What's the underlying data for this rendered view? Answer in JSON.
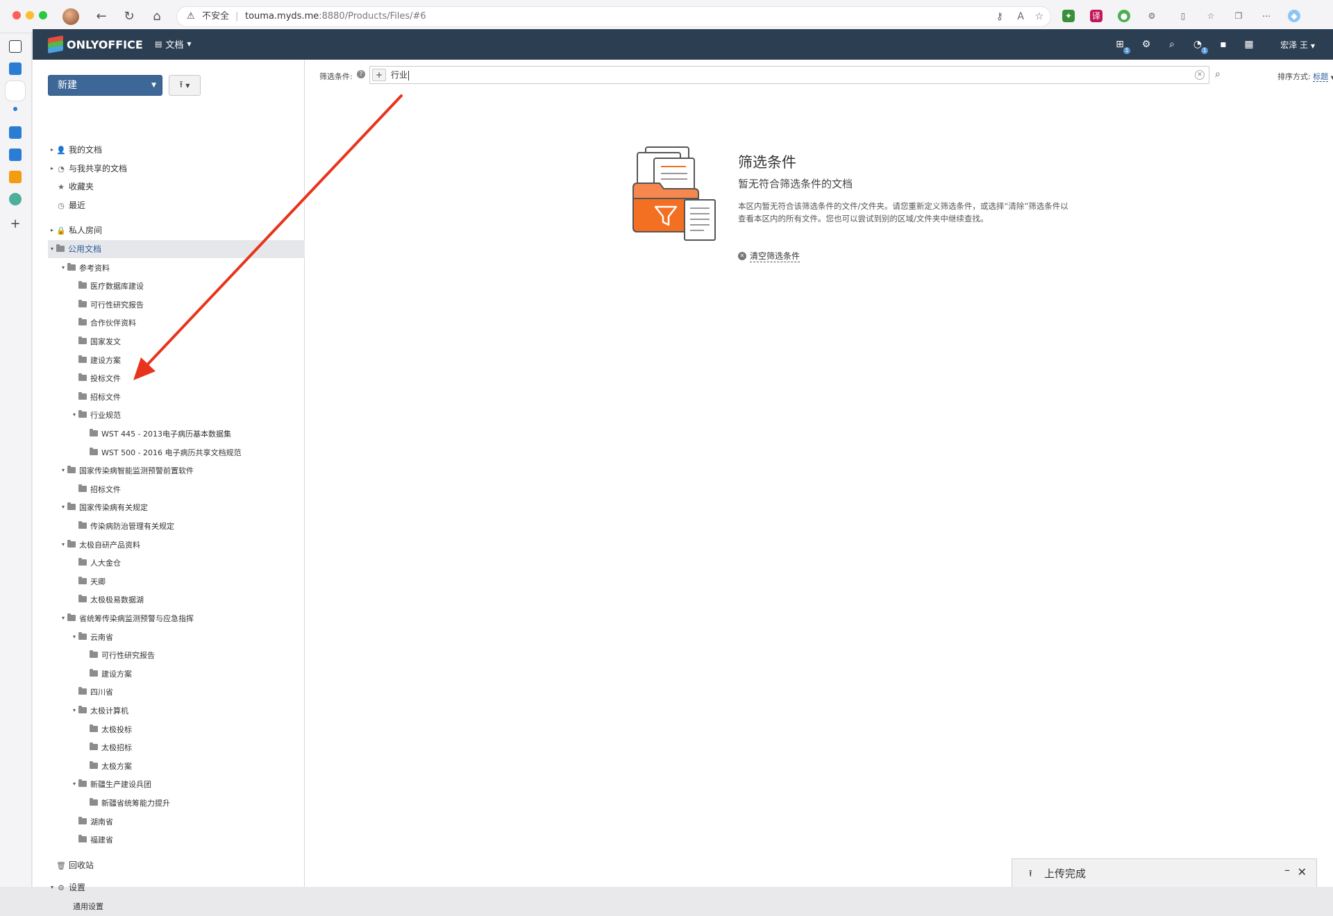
{
  "browser": {
    "insecure_label": "不安全",
    "url_host": "touma.myds.me",
    "url_rest": ":8880/Products/Files/#6"
  },
  "app": {
    "logo_text": "ONLYOFFICE",
    "module_label": "文档",
    "user_name": "宏泽 王",
    "badge_count": "1"
  },
  "sidebar": {
    "new_button": "新建",
    "tree": [
      {
        "label": "我的文档",
        "indent": 0,
        "toggle": "▸",
        "icon": "user-icon"
      },
      {
        "label": "与我共享的文档",
        "indent": 0,
        "toggle": "▸",
        "icon": "share-icon"
      },
      {
        "label": "收藏夹",
        "indent": 0,
        "toggle": "",
        "icon": "star-icon"
      },
      {
        "label": "最近",
        "indent": 0,
        "toggle": "",
        "icon": "clock-icon"
      },
      {
        "label": "私人房间",
        "indent": 0,
        "toggle": "▸",
        "icon": "lock-icon"
      },
      {
        "label": "公用文档",
        "indent": 0,
        "toggle": "▾",
        "icon": "folder-icon",
        "selected": true
      },
      {
        "label": "参考资料",
        "indent": 1,
        "toggle": "▾",
        "icon": "folder-icon"
      },
      {
        "label": "医疗数据库建设",
        "indent": 2,
        "toggle": "",
        "icon": "folder-icon"
      },
      {
        "label": "可行性研究报告",
        "indent": 2,
        "toggle": "",
        "icon": "folder-icon"
      },
      {
        "label": "合作伙伴资料",
        "indent": 2,
        "toggle": "",
        "icon": "folder-icon"
      },
      {
        "label": "国家发文",
        "indent": 2,
        "toggle": "",
        "icon": "folder-icon"
      },
      {
        "label": "建设方案",
        "indent": 2,
        "toggle": "",
        "icon": "folder-icon"
      },
      {
        "label": "投标文件",
        "indent": 2,
        "toggle": "",
        "icon": "folder-icon"
      },
      {
        "label": "招标文件",
        "indent": 2,
        "toggle": "",
        "icon": "folder-icon"
      },
      {
        "label": "行业规范",
        "indent": 2,
        "toggle": "▾",
        "icon": "folder-icon"
      },
      {
        "label": "WST 445 - 2013电子病历基本数据集",
        "indent": 3,
        "toggle": "",
        "icon": "folder-icon"
      },
      {
        "label": "WST 500 - 2016 电子病历共享文档规范",
        "indent": 3,
        "toggle": "",
        "icon": "folder-icon"
      },
      {
        "label": "国家传染病智能监测预警前置软件",
        "indent": 1,
        "toggle": "▾",
        "icon": "folder-icon"
      },
      {
        "label": "招标文件",
        "indent": 2,
        "toggle": "",
        "icon": "folder-icon"
      },
      {
        "label": "国家传染病有关规定",
        "indent": 1,
        "toggle": "▾",
        "icon": "folder-icon"
      },
      {
        "label": "传染病防治管理有关规定",
        "indent": 2,
        "toggle": "",
        "icon": "folder-icon"
      },
      {
        "label": "太极自研产品资料",
        "indent": 1,
        "toggle": "▾",
        "icon": "folder-icon"
      },
      {
        "label": "人大金仓",
        "indent": 2,
        "toggle": "",
        "icon": "folder-icon"
      },
      {
        "label": "天卿",
        "indent": 2,
        "toggle": "",
        "icon": "folder-icon"
      },
      {
        "label": "太极极易数据湖",
        "indent": 2,
        "toggle": "",
        "icon": "folder-icon"
      },
      {
        "label": "省统筹传染病监测预警与应急指挥",
        "indent": 1,
        "toggle": "▾",
        "icon": "folder-icon"
      },
      {
        "label": "云南省",
        "indent": 2,
        "toggle": "▾",
        "icon": "folder-icon"
      },
      {
        "label": "可行性研究报告",
        "indent": 3,
        "toggle": "",
        "icon": "folder-icon"
      },
      {
        "label": "建设方案",
        "indent": 3,
        "toggle": "",
        "icon": "folder-icon"
      },
      {
        "label": "四川省",
        "indent": 2,
        "toggle": "",
        "icon": "folder-icon"
      },
      {
        "label": "太极计算机",
        "indent": 2,
        "toggle": "▾",
        "icon": "folder-icon"
      },
      {
        "label": "太极投标",
        "indent": 3,
        "toggle": "",
        "icon": "folder-icon"
      },
      {
        "label": "太极招标",
        "indent": 3,
        "toggle": "",
        "icon": "folder-icon"
      },
      {
        "label": "太极方案",
        "indent": 3,
        "toggle": "",
        "icon": "folder-icon"
      },
      {
        "label": "新疆生产建设兵团",
        "indent": 2,
        "toggle": "▾",
        "icon": "folder-icon"
      },
      {
        "label": "新疆省统筹能力提升",
        "indent": 3,
        "toggle": "",
        "icon": "folder-icon"
      },
      {
        "label": "湖南省",
        "indent": 2,
        "toggle": "",
        "icon": "folder-icon"
      },
      {
        "label": "福建省",
        "indent": 2,
        "toggle": "",
        "icon": "folder-icon"
      },
      {
        "label": "回收站",
        "indent": 0,
        "toggle": "",
        "icon": "trash-icon"
      },
      {
        "label": "设置",
        "indent": 0,
        "toggle": "▾",
        "icon": "gear-icon"
      },
      {
        "label": "通用设置",
        "indent": 1,
        "toggle": "",
        "icon": ""
      }
    ]
  },
  "filter": {
    "label": "筛选条件:",
    "query": "行业",
    "sort_label": "排序方式:",
    "sort_value": "标题"
  },
  "empty": {
    "title": "筛选条件",
    "subtitle": "暂无符合筛选条件的文档",
    "description": "本区内暂无符合该筛选条件的文件/文件夹。请您重新定义筛选条件，或选择“清除”筛选条件以查看本区内的所有文件。您也可以尝试到别的区域/文件夹中继续查找。",
    "clear_link": "清空筛选条件"
  },
  "upload": {
    "status": "上传完成"
  },
  "colors": {
    "topbar": "#2c3e52",
    "accent": "#3d6796",
    "arrow": "#e8341c"
  }
}
